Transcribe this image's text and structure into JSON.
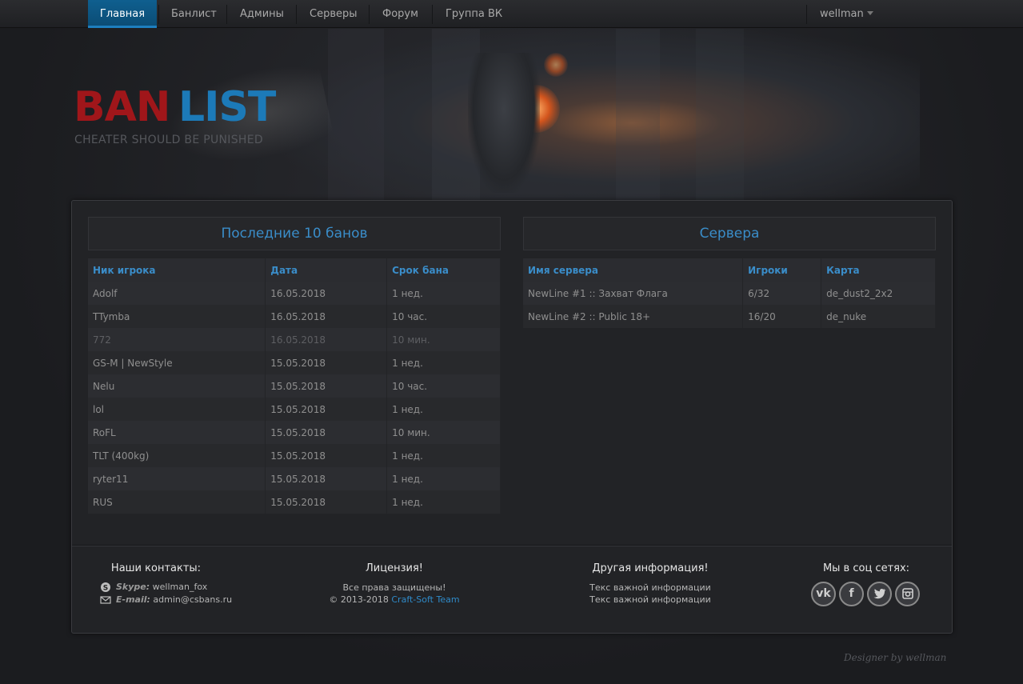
{
  "nav": {
    "items": [
      {
        "label": "Главная",
        "active": true
      },
      {
        "label": "Банлист",
        "active": false
      },
      {
        "label": "Админы",
        "active": false
      },
      {
        "label": "Серверы",
        "active": false
      },
      {
        "label": "Форум",
        "active": false
      },
      {
        "label": "Группа ВК",
        "active": false
      }
    ],
    "user": "wellman"
  },
  "header": {
    "logo_ban": "BAN",
    "logo_list": "LIST",
    "tagline": "CHEATER SHOULD BE PUNISHED"
  },
  "bans": {
    "title": "Последние 10 банов",
    "columns": [
      "Ник игрока",
      "Дата",
      "Срок бана"
    ],
    "rows": [
      {
        "nick": "Adolf",
        "date": "16.05.2018",
        "term": "1 нед."
      },
      {
        "nick": "TTymba",
        "date": "16.05.2018",
        "term": "10 час."
      },
      {
        "nick": "772",
        "date": "16.05.2018",
        "term": "10 мин."
      },
      {
        "nick": "GS-M | NewStyle",
        "date": "15.05.2018",
        "term": "1 нед."
      },
      {
        "nick": "Nelu",
        "date": "15.05.2018",
        "term": "10 час."
      },
      {
        "nick": "lol",
        "date": "15.05.2018",
        "term": "1 нед."
      },
      {
        "nick": "RoFL",
        "date": "15.05.2018",
        "term": "10 мин."
      },
      {
        "nick": "TLT (400kg)",
        "date": "15.05.2018",
        "term": "1 нед."
      },
      {
        "nick": "ryter11",
        "date": "15.05.2018",
        "term": "1 нед."
      },
      {
        "nick": "RUS",
        "date": "15.05.2018",
        "term": "1 нед."
      }
    ]
  },
  "servers": {
    "title": "Сервера",
    "columns": [
      "Имя сервера",
      "Игроки",
      "Карта"
    ],
    "rows": [
      {
        "name": "NewLine #1 :: Захват Флага",
        "players": "6/32",
        "map": "de_dust2_2x2"
      },
      {
        "name": "NewLine #2 :: Public 18+",
        "players": "16/20",
        "map": "de_nuke"
      }
    ]
  },
  "footer": {
    "contacts": {
      "title": "Наши контакты:",
      "skype_label": "Skype:",
      "skype_value": "wellman_fox",
      "email_label": "E-mail:",
      "email_value": "admin@csbans.ru"
    },
    "license": {
      "title": "Лицензия!",
      "line1": "Все права защищены!",
      "line2_prefix": "© 2013-2018 ",
      "line2_link": "Craft-Soft Team"
    },
    "other": {
      "title": "Другая информация!",
      "line1": "Текс важной информации",
      "line2": "Текс важной информации"
    },
    "social": {
      "title": "Мы в соц сетях:",
      "icons": [
        "vk-icon",
        "facebook-icon",
        "twitter-icon",
        "instagram-icon"
      ]
    }
  },
  "designer": "Designer by wellman",
  "colors": {
    "accent": "#3a8dc9",
    "logo_red": "#a0161a",
    "logo_blue": "#1c7ab8",
    "nav_active": "#0f5f8f"
  }
}
